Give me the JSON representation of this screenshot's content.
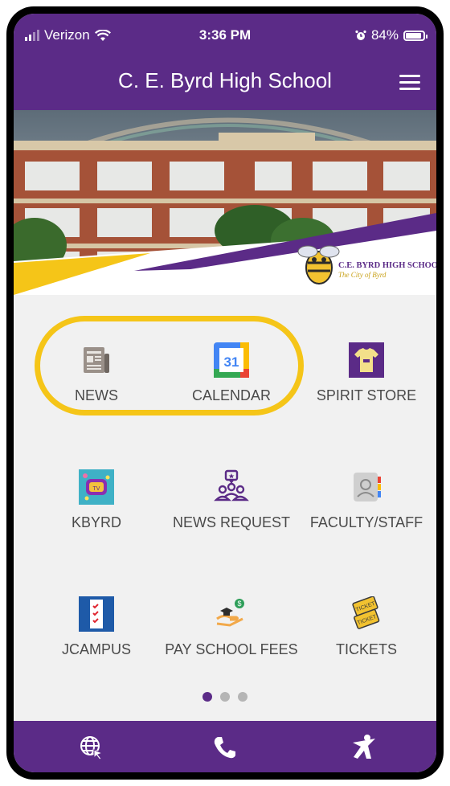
{
  "status_bar": {
    "carrier": "Verizon",
    "time": "3:36 PM",
    "battery": "84%"
  },
  "header": {
    "title": "C. E. Byrd High School"
  },
  "banner": {
    "logo_line1": "C.E. BYRD HIGH SCHOOL",
    "logo_line2": "The City of Byrd"
  },
  "tiles": [
    {
      "label": "NEWS",
      "icon": "newspaper-icon"
    },
    {
      "label": "CALENDAR",
      "icon": "calendar-icon",
      "calendar_day": "31"
    },
    {
      "label": "SPIRIT STORE",
      "icon": "tshirt-icon"
    },
    {
      "label": "KBYRD",
      "icon": "kbyrd-icon"
    },
    {
      "label": "NEWS REQUEST",
      "icon": "people-request-icon"
    },
    {
      "label": "FACULTY/STAFF",
      "icon": "contacts-book-icon"
    },
    {
      "label": "JCAMPUS",
      "icon": "jcampus-icon"
    },
    {
      "label": "PAY SCHOOL FEES",
      "icon": "pay-fees-icon"
    },
    {
      "label": "TICKETS",
      "icon": "tickets-icon"
    }
  ],
  "pagination": {
    "pages": 3,
    "active": 1
  },
  "tabbar": {
    "items": [
      "globe-web-icon",
      "phone-icon",
      "athlete-icon"
    ]
  },
  "colors": {
    "brand_purple": "#5b2b87",
    "highlight_yellow": "#f5c518",
    "background": "#f1f1f1"
  }
}
